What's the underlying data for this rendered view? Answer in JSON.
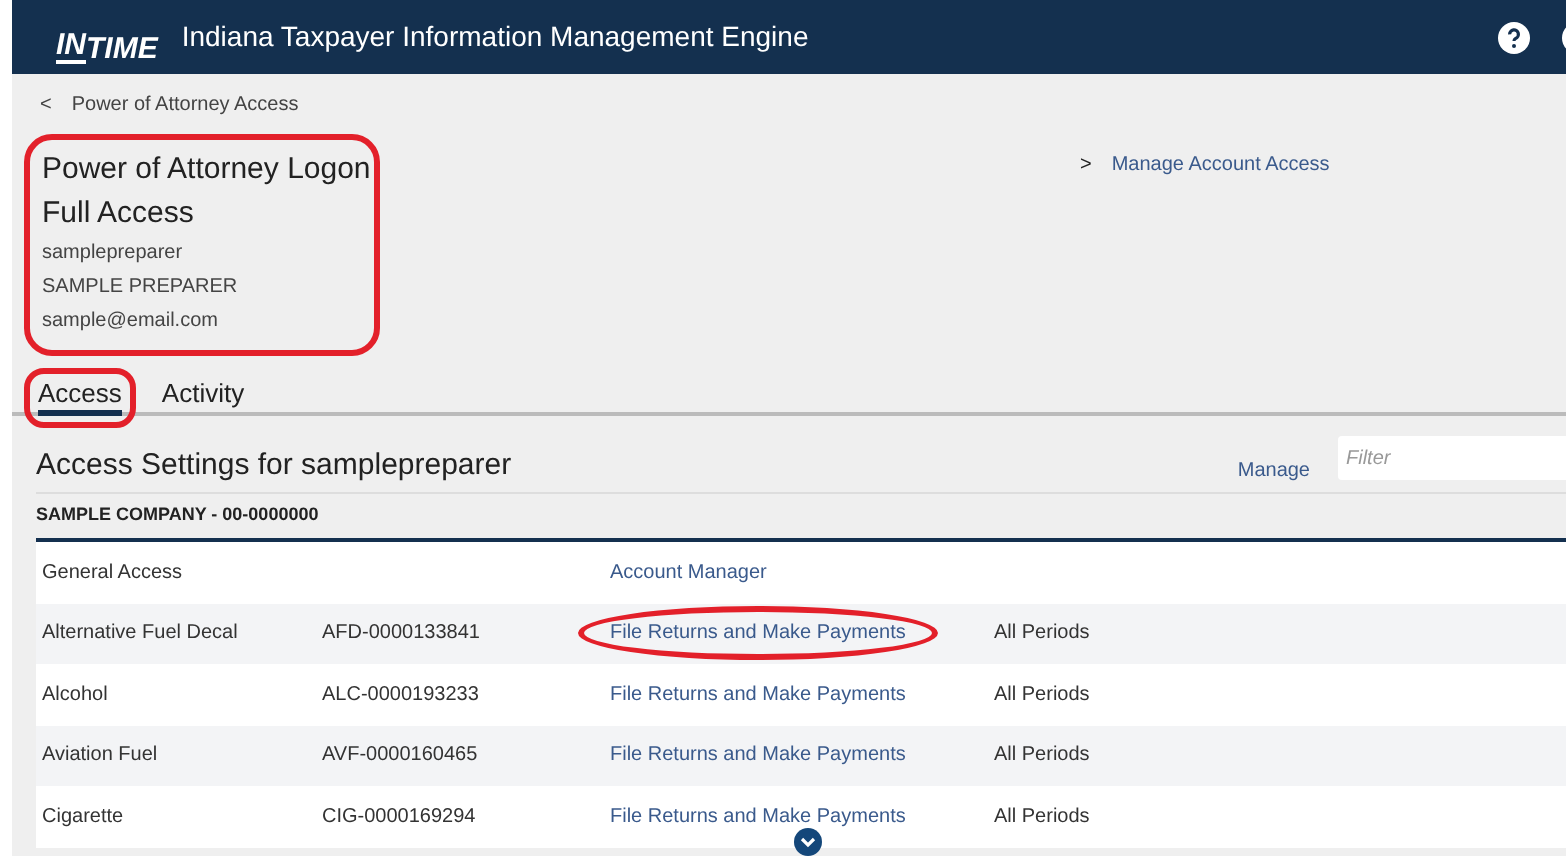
{
  "header": {
    "logo": "IN",
    "logo_suffix": "TIME",
    "title": "Indiana Taxpayer Information Management Engine"
  },
  "breadcrumb": {
    "icon": "<",
    "label": "Power of Attorney Access"
  },
  "profile": {
    "highlighted": true,
    "title": "Power of Attorney Logon",
    "access": "Full Access",
    "username": "samplepreparer",
    "name": "SAMPLE PREPARER",
    "email": "sample@email.com"
  },
  "side_link": {
    "icon": ">",
    "label": "Manage Account Access"
  },
  "tabs": [
    {
      "label": "Access",
      "selected": true,
      "highlighted": true
    },
    {
      "label": "Activity",
      "selected": false,
      "highlighted": false
    }
  ],
  "section": {
    "title": "Access Settings for samplepreparer",
    "manage": "Manage",
    "filter": {
      "placeholder": "Filter"
    }
  },
  "company": "SAMPLE COMPANY - 00-0000000",
  "rows": [
    {
      "tax_type": "General Access",
      "account": "",
      "role": "Account Manager",
      "periods": "",
      "highlighted": false
    },
    {
      "tax_type": "Alternative Fuel Decal",
      "account": "AFD-0000133841",
      "role": "File Returns and Make Payments",
      "periods": "All Periods",
      "highlighted": true
    },
    {
      "tax_type": "Alcohol",
      "account": "ALC-0000193233",
      "role": "File Returns and Make Payments",
      "periods": "All Periods",
      "highlighted": false
    },
    {
      "tax_type": "Aviation Fuel",
      "account": "AVF-0000160465",
      "role": "File Returns and Make Payments",
      "periods": "All Periods",
      "highlighted": false
    },
    {
      "tax_type": "Cigarette",
      "account": "CIG-0000169294",
      "role": "File Returns and Make Payments",
      "periods": "All Periods",
      "highlighted": false
    }
  ]
}
